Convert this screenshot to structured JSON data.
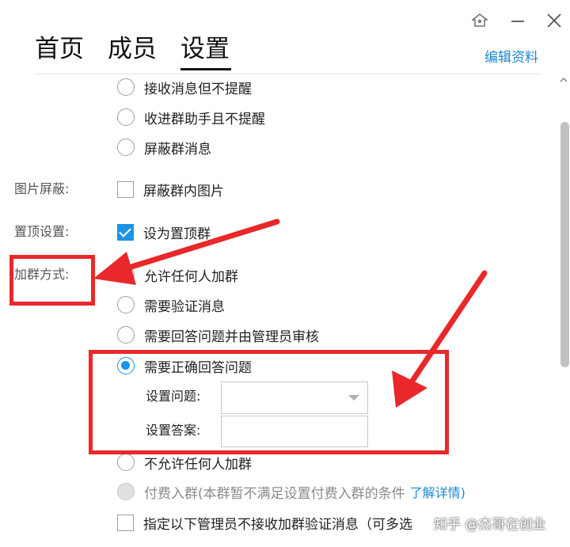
{
  "window": {
    "controls": {
      "skin": "skin-icon",
      "minimize": "minimize-icon",
      "close": "close-icon"
    }
  },
  "tabs": [
    {
      "label": "首页",
      "active": false
    },
    {
      "label": "成员",
      "active": false
    },
    {
      "label": "设置",
      "active": true
    }
  ],
  "header": {
    "edit_profile": "编辑资料"
  },
  "message_options": [
    {
      "label": "接收消息但不提醒",
      "checked": false
    },
    {
      "label": "收进群助手且不提醒",
      "checked": false
    },
    {
      "label": "屏蔽群消息",
      "checked": false
    }
  ],
  "image_block": {
    "section_label": "图片屏蔽:",
    "option": "屏蔽群内图片",
    "checked": false
  },
  "pin": {
    "section_label": "置顶设置:",
    "option": "设为置顶群",
    "checked": true
  },
  "join": {
    "section_label": "加群方式:",
    "options": [
      {
        "label": "允许任何人加群",
        "checked": false
      },
      {
        "label": "需要验证消息",
        "checked": false
      },
      {
        "label": "需要回答问题并由管理员审核",
        "checked": false
      },
      {
        "label": "需要正确回答问题",
        "checked": true
      }
    ],
    "question_label": "设置问题:",
    "question_value": "",
    "answer_label": "设置答案:",
    "answer_value": "",
    "deny_all": "不允许任何人加群",
    "paid": "付费入群(本群暂不满足设置付费入群的条件",
    "paid_link": "了解详情)",
    "admin_exclude": "指定以下管理员不接收加群验证消息（可多选"
  },
  "watermark": "知乎 @杰哥在创业",
  "colors": {
    "accent": "#1a94e6",
    "annotation_red": "#e8282a",
    "link": "#1e88d4"
  }
}
